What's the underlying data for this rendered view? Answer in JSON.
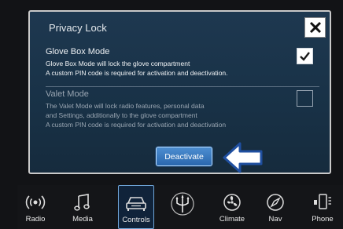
{
  "dialog": {
    "title": "Privacy Lock",
    "close_symbol": "close-icon",
    "glove_box": {
      "title": "Glove Box Mode",
      "lines": [
        "Glove Box Mode will lock the glove compartment",
        "A custom PIN code is required for activation and deactivation."
      ],
      "checked": true
    },
    "valet": {
      "title": "Valet Mode",
      "lines": [
        "The Valet Mode will lock radio features, personal data",
        "and Settings, additionally to the glove compartment",
        "A custom PIN code is required for activation and deactivation"
      ],
      "checked": false
    },
    "deactivate_label": "Deactivate"
  },
  "nav": {
    "items": [
      {
        "label": "Radio",
        "icon": "radio-icon"
      },
      {
        "label": "Media",
        "icon": "music-note-icon"
      },
      {
        "label": "Controls",
        "icon": "car-icon",
        "active": true
      },
      {
        "label": "",
        "icon": "trident-logo-icon"
      },
      {
        "label": "Climate",
        "icon": "fan-icon"
      },
      {
        "label": "Nav",
        "icon": "compass-icon"
      },
      {
        "label": "Phone",
        "icon": "phone-icon"
      }
    ]
  },
  "colors": {
    "dialog_bg": "#1b3449",
    "accent_blue": "#3a7cc4",
    "arrow_blue": "#1f4fa0",
    "checkbox_active": "#ffffff"
  }
}
